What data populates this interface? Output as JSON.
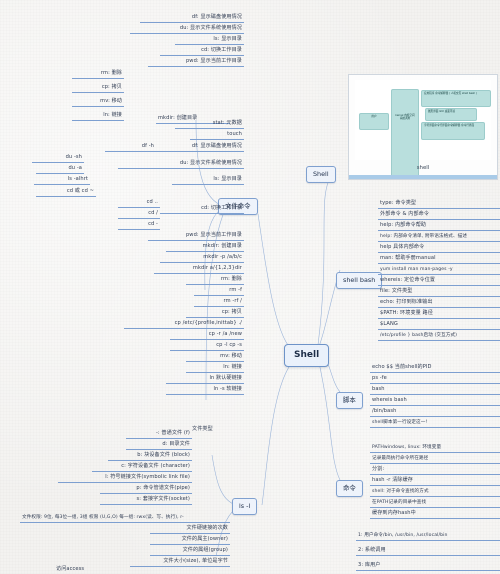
{
  "app": {
    "type": "mindmap",
    "background_color": "#f3f2f0",
    "node_border_color": "#7fa0cf",
    "node_fill_color": "#eef3fb",
    "line_color": "#8aa8d4",
    "text_color": "#2f3b52"
  },
  "root": {
    "label": "Shell"
  },
  "branches": {
    "file_commands": {
      "label": "文件命令",
      "leaves": [
        "df: 显示磁盘使用情况",
        "du: 显示文件系统使用情况",
        "ls: 显示目录",
        "cd: 切换工作目录",
        "pwd: 显示当前工作目录",
        "mkdir: 创建目录",
        "stat: 元数据",
        "touch",
        "rm: 删除",
        "cp: 拷贝",
        "mv: 移动",
        "ln: 链接"
      ],
      "sub_leaves": [
        "df -h",
        "du -sh",
        "du -a",
        "ls -alhrt",
        "cd 或 cd ~",
        "cd ..",
        "cd /",
        "cd -",
        "mkdir -p /a/b/c",
        "mkdir a/{1,2,3}dir",
        "rm -f",
        "rm -rf /",
        "cp /etc/{profile,inittab} ./",
        "cp -r /a /new",
        "cp -l  cp -s",
        "ln 默认硬链接",
        "ln -s 软链接"
      ]
    },
    "ls_l": {
      "label": "ls -l",
      "file_type_label": "文件类型",
      "file_types": [
        "-: 普通文件 (f)",
        "d: 目录文件",
        "b: 块设备文件 (block)",
        "c: 字符设备文件 (character)",
        "l: 符号链接文件(symbolic link file)",
        "p: 命令管道文件(pipe)",
        "s: 套接字文件(socket)"
      ],
      "fields": [
        "文件权限: 9位, 每3位一组, 3组 权限 (U,G,O) 每一组: rwx(读、写、执行), r-",
        "文件硬链接的次数",
        "文件的属主(owner)",
        "文件的属组(group)",
        "文件大小(size), 单位是字节"
      ],
      "access": "访问access"
    },
    "shell_node": {
      "label": "Shell",
      "picture": {
        "caption": "shell",
        "boxes": [
          "用户",
          "kernel 内核空间 系统调用",
          "应用程序 命令解释器 ( 人机交互 shell bash )",
          "图形界面 GUI 桌面环境",
          "字符界面命令行界面命令解释器 命令行界面"
        ]
      }
    },
    "shell_bash": {
      "label": "shell bash",
      "leaves": [
        "type: 命令类型",
        "外部命令 & 内部命令",
        "help: 内部命令帮助",
        "help: 内部命令清单, 附带语法格式、描述",
        "help 具体内部命令",
        "man: 帮助手册manual",
        "yum install man man-pages -y",
        "whereis: 定位命令位置",
        "file: 文件类型",
        "echo: 打印到标准输出",
        "$PATH: 环境变量  路径",
        "$LANG",
        "/etc/profile  }  bash启动 (交互方式)"
      ]
    },
    "script": {
      "label": "脚本",
      "leaves": [
        "echo $$  当前shell的PID",
        "ps -fe",
        "bash",
        "whereis bash",
        "/bin/bash",
        "shell脚本第一行设定这一!"
      ]
    },
    "command": {
      "label": "命令",
      "leaves": [
        "PATHwindows, linux: 环境变量",
        "记录最简执行命令所在路径",
        "分割:",
        "hash -r 清除缓存",
        "shell: 对于命令查找的方式",
        "在PATH记录的目录中查找",
        "缓存到内存hash中"
      ],
      "man_sections": [
        "1: 用户命令/bin, /usr/bin, /usr/local/bin",
        "2: 系统调用",
        "3: 库用户"
      ]
    }
  }
}
